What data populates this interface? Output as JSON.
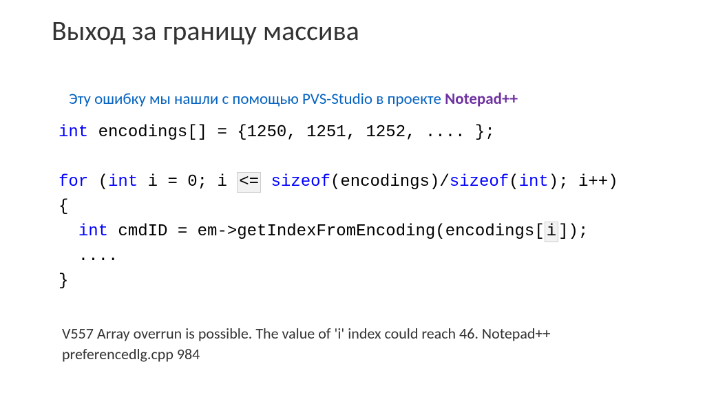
{
  "title": "Выход за границу массива",
  "subtitle_prefix": "Эту ошибку мы нашли с помощью PVS-Studio в проекте ",
  "subtitle_project": "Notepad++",
  "code": {
    "l1_int": "int",
    "l1_rest": " encodings[] = {1250, 1251, 1252, .... };",
    "l3_for": "for",
    "l3_a": " (",
    "l3_int": "int",
    "l3_b": " i = 0; i ",
    "l3_op": "<=",
    "l3_c": " ",
    "l3_sizeof1": "sizeof",
    "l3_d": "(encodings)/",
    "l3_sizeof2": "sizeof",
    "l3_e": "(",
    "l3_int2": "int",
    "l3_f": "); i++)",
    "l4": "{",
    "l5_a": "  ",
    "l5_int": "int",
    "l5_b": " cmdID = em->getIndexFromEncoding(encodings[",
    "l5_i": "i",
    "l5_c": "]);",
    "l6": "  ....",
    "l7": "}"
  },
  "footer": "V557 Array overrun is possible. The value of 'i' index could reach 46.  Notepad++ preferencedlg.cpp  984"
}
